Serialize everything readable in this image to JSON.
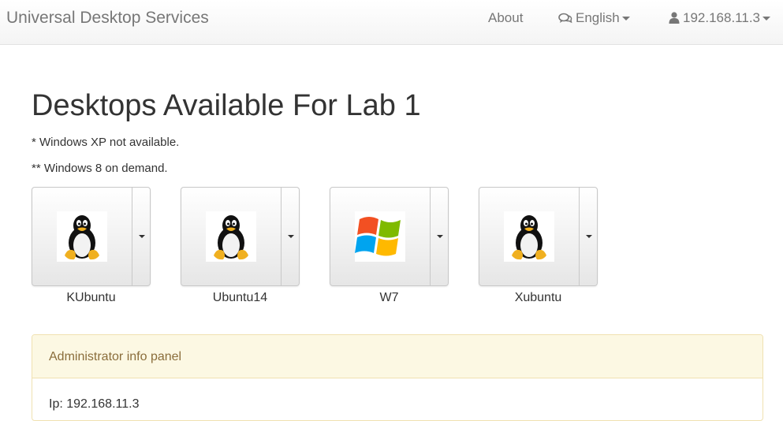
{
  "navbar": {
    "brand": "Universal Desktop Services",
    "about": "About",
    "language": "English",
    "user": "192.168.11.3"
  },
  "page": {
    "title": "Desktops Available For Lab 1",
    "note1": "* Windows XP not available.",
    "note2": "** Windows 8 on demand."
  },
  "desktops": [
    {
      "label": "KUbuntu",
      "icon": "linux-tux-icon"
    },
    {
      "label": "Ubuntu14",
      "icon": "linux-tux-icon"
    },
    {
      "label": "W7",
      "icon": "windows-logo-icon"
    },
    {
      "label": "Xubuntu",
      "icon": "linux-tux-icon"
    }
  ],
  "admin_panel": {
    "heading": "Administrator info panel",
    "ip_line": "Ip: 192.168.11.3"
  }
}
